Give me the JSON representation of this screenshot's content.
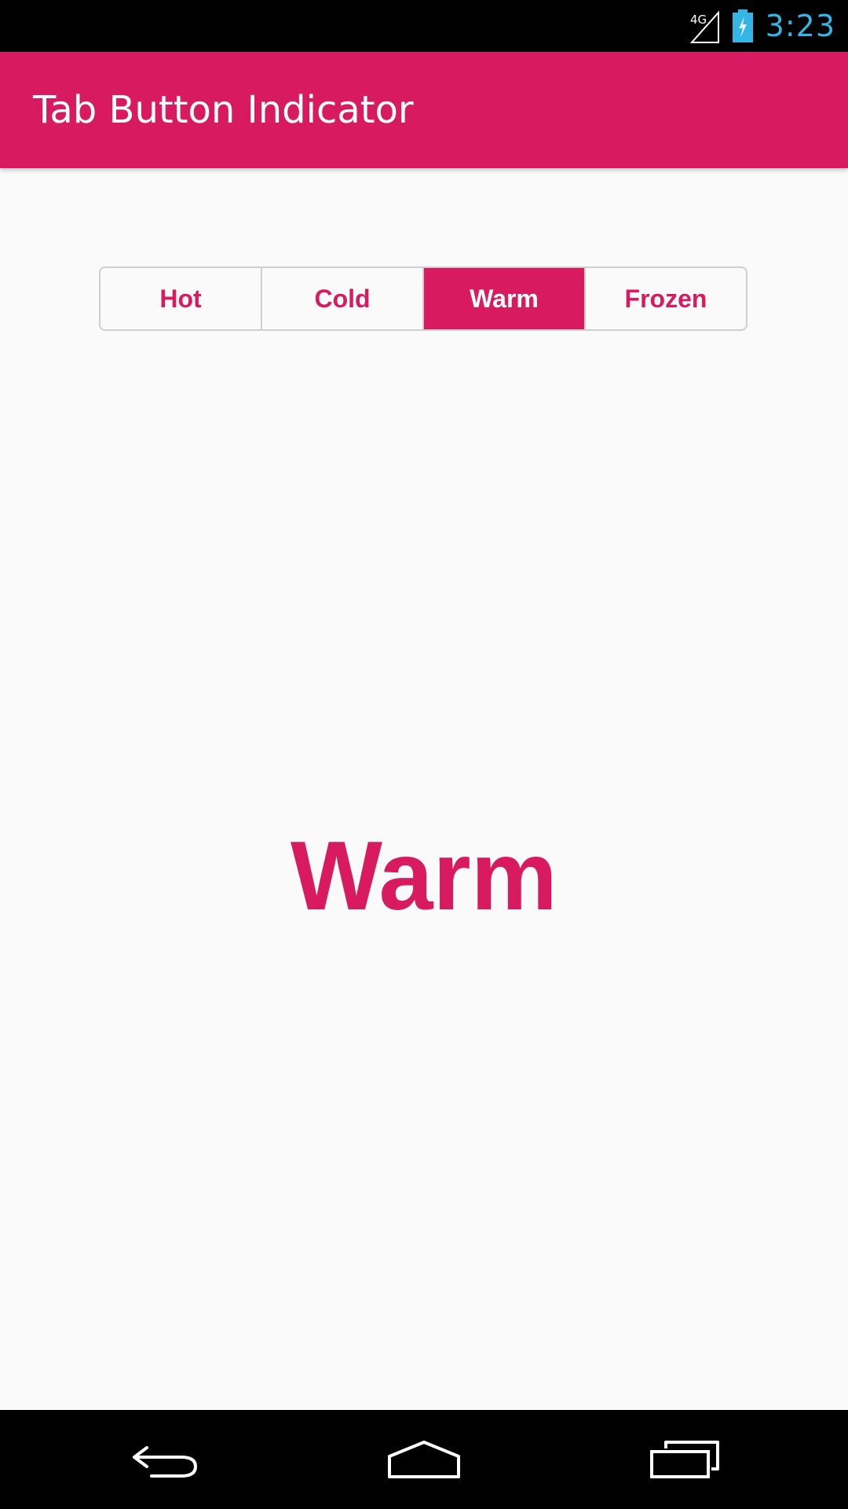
{
  "status_bar": {
    "network_label": "4G",
    "time": "3:23",
    "clock_color": "#33b5e5",
    "icons": [
      "signal-icon",
      "battery-icon"
    ]
  },
  "app_bar": {
    "title": "Tab Button Indicator",
    "color": "#d81b60"
  },
  "tabs": [
    {
      "label": "Hot",
      "selected": false
    },
    {
      "label": "Cold",
      "selected": false
    },
    {
      "label": "Warm",
      "selected": true
    },
    {
      "label": "Frozen",
      "selected": false
    }
  ],
  "content": {
    "selected_label": "Warm"
  },
  "nav_bar": {
    "buttons": [
      "back-icon",
      "home-icon",
      "recents-icon"
    ]
  },
  "colors": {
    "accent": "#d81b60",
    "background": "#fafafa"
  }
}
